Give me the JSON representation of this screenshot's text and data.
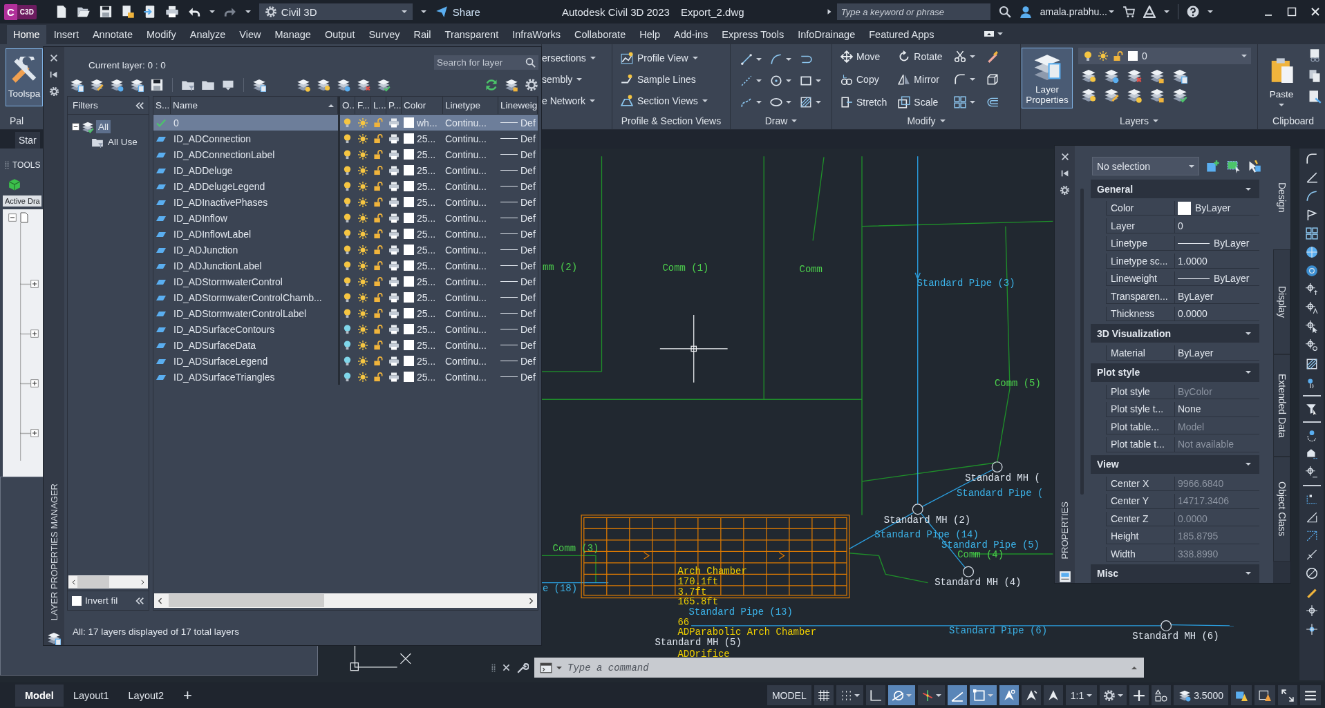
{
  "app": {
    "logo_letter": "C",
    "logo_badge": "C3D"
  },
  "quick_access": {
    "workspace": "Civil 3D",
    "share": "Share"
  },
  "window": {
    "title": "Autodesk Civil 3D 2023",
    "file": "Export_2.dwg"
  },
  "search": {
    "placeholder": "Type a keyword or phrase"
  },
  "user": {
    "name": "amala.prabhu..."
  },
  "ribbon": {
    "tabs": [
      {
        "label": "Home",
        "selected": true
      },
      {
        "label": "Insert",
        "selected": false
      },
      {
        "label": "Annotate",
        "selected": false
      },
      {
        "label": "Modify",
        "selected": false
      },
      {
        "label": "Analyze",
        "selected": false
      },
      {
        "label": "View",
        "selected": false
      },
      {
        "label": "Manage",
        "selected": false
      },
      {
        "label": "Output",
        "selected": false
      },
      {
        "label": "Survey",
        "selected": false
      },
      {
        "label": "Rail",
        "selected": false
      },
      {
        "label": "Transparent",
        "selected": false
      },
      {
        "label": "InfraWorks",
        "selected": false
      },
      {
        "label": "Collaborate",
        "selected": false
      },
      {
        "label": "Help",
        "selected": false
      },
      {
        "label": "Add-ins",
        "selected": false
      },
      {
        "label": "Express Tools",
        "selected": false
      },
      {
        "label": "InfoDrainage",
        "selected": false
      },
      {
        "label": "Featured Apps",
        "selected": false
      }
    ],
    "palettes_panel": {
      "button": "Toolspa",
      "title": "Pal"
    },
    "partial_panel": {
      "items": [
        "ersections",
        "sembly",
        "e Network"
      ]
    },
    "profile_panel": {
      "items": [
        "Profile View",
        "Sample Lines",
        "Section Views"
      ],
      "title": "Profile & Section Views"
    },
    "draw_panel": {
      "title": "Draw"
    },
    "modify_panel": {
      "items": [
        "Move",
        "Rotate",
        "Copy",
        "Mirror",
        "Stretch",
        "Scale"
      ],
      "title": "Modify"
    },
    "layers_panel": {
      "button": "Layer Properties",
      "current_layer": "0",
      "title": "Layers"
    },
    "clipboard_panel": {
      "button": "Paste",
      "title": "Clipboard"
    }
  },
  "file_tabs": [
    {
      "label": "Star"
    }
  ],
  "tool_palette": {
    "title": "TOOLS",
    "tab": "Active Dra"
  },
  "layer_manager": {
    "side_title": "LAYER PROPERTIES MANAGER",
    "current_layer": "Current layer: 0 : 0",
    "search_placeholder": "Search for layer",
    "filters": {
      "title": "Filters",
      "tree": [
        {
          "label": "All",
          "selected": true,
          "children": [
            {
              "label": "All Use",
              "selected": false
            }
          ]
        }
      ],
      "invert": {
        "label": "Invert fil",
        "checked": false
      }
    },
    "columns": [
      "S...",
      "Name",
      "O..",
      "F...",
      "L...",
      "P...",
      "Color",
      "Linetype",
      "Lineweig"
    ],
    "layers": [
      {
        "name": "0",
        "current": true,
        "selected": true,
        "on": true,
        "color_name": "wh...",
        "linetype": "Continu...",
        "lineweight": "Def"
      },
      {
        "name": "ID_ADConnection",
        "current": false,
        "selected": false,
        "on": true,
        "color_name": "25...",
        "linetype": "Continu...",
        "lineweight": "Def"
      },
      {
        "name": "ID_ADConnectionLabel",
        "current": false,
        "selected": false,
        "on": true,
        "color_name": "25...",
        "linetype": "Continu...",
        "lineweight": "Def"
      },
      {
        "name": "ID_ADDeluge",
        "current": false,
        "selected": false,
        "on": true,
        "color_name": "25...",
        "linetype": "Continu...",
        "lineweight": "Def"
      },
      {
        "name": "ID_ADDelugeLegend",
        "current": false,
        "selected": false,
        "on": true,
        "color_name": "25...",
        "linetype": "Continu...",
        "lineweight": "Def"
      },
      {
        "name": "ID_ADInactivePhases",
        "current": false,
        "selected": false,
        "on": true,
        "color_name": "25...",
        "linetype": "Continu...",
        "lineweight": "Def"
      },
      {
        "name": "ID_ADInflow",
        "current": false,
        "selected": false,
        "on": true,
        "color_name": "25...",
        "linetype": "Continu...",
        "lineweight": "Def"
      },
      {
        "name": "ID_ADInflowLabel",
        "current": false,
        "selected": false,
        "on": true,
        "color_name": "25...",
        "linetype": "Continu...",
        "lineweight": "Def"
      },
      {
        "name": "ID_ADJunction",
        "current": false,
        "selected": false,
        "on": true,
        "color_name": "25...",
        "linetype": "Continu...",
        "lineweight": "Def"
      },
      {
        "name": "ID_ADJunctionLabel",
        "current": false,
        "selected": false,
        "on": true,
        "color_name": "25...",
        "linetype": "Continu...",
        "lineweight": "Def"
      },
      {
        "name": "ID_ADStormwaterControl",
        "current": false,
        "selected": false,
        "on": true,
        "color_name": "25...",
        "linetype": "Continu...",
        "lineweight": "Def"
      },
      {
        "name": "ID_ADStormwaterControlChamb...",
        "current": false,
        "selected": false,
        "on": true,
        "color_name": "25...",
        "linetype": "Continu...",
        "lineweight": "Def"
      },
      {
        "name": "ID_ADStormwaterControlLabel",
        "current": false,
        "selected": false,
        "on": true,
        "color_name": "25...",
        "linetype": "Continu...",
        "lineweight": "Def"
      },
      {
        "name": "ID_ADSurfaceContours",
        "current": false,
        "selected": false,
        "on": false,
        "color_name": "25...",
        "linetype": "Continu...",
        "lineweight": "Def"
      },
      {
        "name": "ID_ADSurfaceData",
        "current": false,
        "selected": false,
        "on": false,
        "color_name": "25...",
        "linetype": "Continu...",
        "lineweight": "Def"
      },
      {
        "name": "ID_ADSurfaceLegend",
        "current": false,
        "selected": false,
        "on": false,
        "color_name": "25...",
        "linetype": "Continu...",
        "lineweight": "Def"
      },
      {
        "name": "ID_ADSurfaceTriangles",
        "current": false,
        "selected": false,
        "on": false,
        "color_name": "25...",
        "linetype": "Continu...",
        "lineweight": "Def"
      }
    ],
    "status": "All: 17 layers displayed of 17 total layers"
  },
  "properties": {
    "side_title": "PROPERTIES",
    "selection": "No selection",
    "sections": [
      {
        "title": "General",
        "expanded": true,
        "rows": [
          {
            "label": "Color",
            "value": "ByLayer",
            "kind": "swatch",
            "disabled": false
          },
          {
            "label": "Layer",
            "value": "0",
            "kind": "text",
            "disabled": false
          },
          {
            "label": "Linetype",
            "value": "ByLayer",
            "kind": "line",
            "disabled": false
          },
          {
            "label": "Linetype sc...",
            "value": "1.0000",
            "kind": "text",
            "disabled": false
          },
          {
            "label": "Lineweight",
            "value": "ByLayer",
            "kind": "line",
            "disabled": false
          },
          {
            "label": "Transparen...",
            "value": "ByLayer",
            "kind": "text",
            "disabled": false
          },
          {
            "label": "Thickness",
            "value": "0.0000",
            "kind": "text",
            "disabled": false
          }
        ]
      },
      {
        "title": "3D Visualization",
        "expanded": true,
        "rows": [
          {
            "label": "Material",
            "value": "ByLayer",
            "kind": "text",
            "disabled": false
          }
        ]
      },
      {
        "title": "Plot style",
        "expanded": true,
        "rows": [
          {
            "label": "Plot style",
            "value": "ByColor",
            "kind": "text",
            "disabled": true
          },
          {
            "label": "Plot style t...",
            "value": "None",
            "kind": "text",
            "disabled": false
          },
          {
            "label": "Plot table...",
            "value": "Model",
            "kind": "text",
            "disabled": true
          },
          {
            "label": "Plot table t...",
            "value": "Not available",
            "kind": "text",
            "disabled": true
          }
        ]
      },
      {
        "title": "View",
        "expanded": true,
        "rows": [
          {
            "label": "Center X",
            "value": "9966.6840",
            "kind": "text",
            "disabled": true
          },
          {
            "label": "Center Y",
            "value": "14717.3406",
            "kind": "text",
            "disabled": true
          },
          {
            "label": "Center Z",
            "value": "0.0000",
            "kind": "text",
            "disabled": true
          },
          {
            "label": "Height",
            "value": "185.8795",
            "kind": "text",
            "disabled": true
          },
          {
            "label": "Width",
            "value": "338.8990",
            "kind": "text",
            "disabled": true
          }
        ]
      },
      {
        "title": "Misc",
        "expanded": true
      }
    ],
    "tabs": [
      {
        "label": "Design",
        "selected": true
      },
      {
        "label": "Display",
        "selected": false
      },
      {
        "label": "Extended Data",
        "selected": false
      },
      {
        "label": "Object Class",
        "selected": false
      }
    ]
  },
  "drawing": {
    "labels": [
      {
        "text": "mm (2)",
        "kind": "catchment"
      },
      {
        "text": "Comm (1)",
        "kind": "catchment"
      },
      {
        "text": "Comm",
        "kind": "catchment"
      },
      {
        "text": "Standard Pipe (3)",
        "kind": "pipe"
      },
      {
        "text": "Comm (5)",
        "kind": "catchment"
      },
      {
        "text": "Standard MH (",
        "kind": "structure"
      },
      {
        "text": "Standard Pipe (",
        "kind": "pipe"
      },
      {
        "text": "Standard MH (2)",
        "kind": "structure"
      },
      {
        "text": "Standard Pipe (14)",
        "kind": "pipe"
      },
      {
        "text": "Standard Pipe (5)",
        "kind": "pipe"
      },
      {
        "text": "Comm (4)",
        "kind": "catchment"
      },
      {
        "text": "Comm (3)",
        "kind": "catchment"
      },
      {
        "text": "Standard MH (4)",
        "kind": "structure"
      },
      {
        "text": "e (18)",
        "kind": "pipe"
      },
      {
        "text": "Arch Chamber",
        "kind": "chamber"
      },
      {
        "text": "170.1ft",
        "kind": "chamber"
      },
      {
        "text": "3.7ft",
        "kind": "chamber"
      },
      {
        "text": "165.8ft",
        "kind": "chamber"
      },
      {
        "text": "Standard Pipe (13)",
        "kind": "pipe"
      },
      {
        "text": "66",
        "kind": "chamber"
      },
      {
        "text": "ADParabolic Arch Chamber",
        "kind": "chamber"
      },
      {
        "text": "Standard MH (5)",
        "kind": "structure"
      },
      {
        "text": "Standard Pipe (6)",
        "kind": "pipe"
      },
      {
        "text": "Standard MH (6)",
        "kind": "structure"
      },
      {
        "text": "ADOrifice",
        "kind": "chamber"
      }
    ]
  },
  "command_line": {
    "placeholder": "Type a command"
  },
  "layout_tabs": [
    {
      "label": "Model",
      "selected": true
    },
    {
      "label": "Layout1",
      "selected": false
    },
    {
      "label": "Layout2",
      "selected": false
    }
  ],
  "layout_add": "+",
  "status_bar": {
    "model": "MODEL",
    "toggles": [
      {
        "kind": "grid",
        "on": false,
        "menu": false
      },
      {
        "kind": "snap",
        "on": false,
        "menu": true
      },
      {
        "kind": "ortho",
        "on": false,
        "menu": false
      },
      {
        "kind": "polar",
        "on": true,
        "menu": true
      },
      {
        "kind": "isodraft",
        "on": false,
        "menu": true
      },
      {
        "kind": "dynucs",
        "on": true,
        "menu": false
      },
      {
        "kind": "selection",
        "on": true,
        "menu": true
      },
      {
        "kind": "annovis",
        "on": true,
        "menu": false
      },
      {
        "kind": "autoscale",
        "on": false,
        "menu": false
      },
      {
        "kind": "annoscale",
        "on": false,
        "menu": false
      }
    ],
    "scale": "1:1",
    "value": "3.5000"
  }
}
